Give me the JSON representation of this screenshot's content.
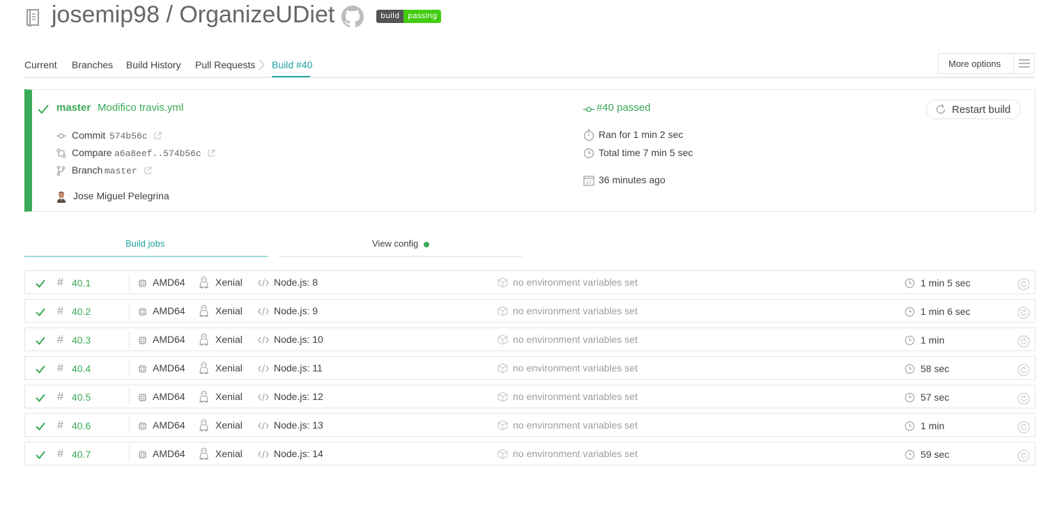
{
  "repo": {
    "owner": "josemip98",
    "separator": "/",
    "name": "OrganizeUDiet",
    "badge_left": "build",
    "badge_right": "passing"
  },
  "nav": {
    "current": "Current",
    "branches": "Branches",
    "build_history": "Build History",
    "pull_requests": "Pull Requests",
    "build": "Build #40",
    "more_options": "More options"
  },
  "build": {
    "branch": "master",
    "message": "Modifico travis.yml",
    "status": "#40 passed",
    "commit_label": "Commit",
    "commit_sha": "574b56c",
    "compare_label": "Compare",
    "compare_range": "a6a8eef..574b56c",
    "branch_label": "Branch",
    "branch_name": "master",
    "author": "Jose Miguel Pelegrina",
    "ran_for": "Ran for 1 min 2 sec",
    "total_time": "Total time 7 min 5 sec",
    "ago": "36 minutes ago",
    "calendar_day": "27",
    "restart": "Restart build"
  },
  "tabs": {
    "build_jobs": "Build jobs",
    "view_config": "View config"
  },
  "jobs": [
    {
      "hash": "#",
      "number": "40.1",
      "arch": "AMD64",
      "os": "Xenial",
      "lang": "Node.js: 8",
      "env": "no environment variables set",
      "duration": "1 min 5 sec"
    },
    {
      "hash": "#",
      "number": "40.2",
      "arch": "AMD64",
      "os": "Xenial",
      "lang": "Node.js: 9",
      "env": "no environment variables set",
      "duration": "1 min 6 sec"
    },
    {
      "hash": "#",
      "number": "40.3",
      "arch": "AMD64",
      "os": "Xenial",
      "lang": "Node.js: 10",
      "env": "no environment variables set",
      "duration": "1 min"
    },
    {
      "hash": "#",
      "number": "40.4",
      "arch": "AMD64",
      "os": "Xenial",
      "lang": "Node.js: 11",
      "env": "no environment variables set",
      "duration": "58 sec"
    },
    {
      "hash": "#",
      "number": "40.5",
      "arch": "AMD64",
      "os": "Xenial",
      "lang": "Node.js: 12",
      "env": "no environment variables set",
      "duration": "57 sec"
    },
    {
      "hash": "#",
      "number": "40.6",
      "arch": "AMD64",
      "os": "Xenial",
      "lang": "Node.js: 13",
      "env": "no environment variables set",
      "duration": "1 min"
    },
    {
      "hash": "#",
      "number": "40.7",
      "arch": "AMD64",
      "os": "Xenial",
      "lang": "Node.js: 14",
      "env": "no environment variables set",
      "duration": "59 sec"
    }
  ],
  "colors": {
    "passed": "#39aa56",
    "accent": "#1fa2a3",
    "badge_passing": "#44cc11",
    "badge_label": "#555555"
  },
  "icons": {
    "repo": "repo-icon",
    "github": "github-icon",
    "check": "check-icon",
    "commit": "commit-icon",
    "compare": "compare-icon",
    "branch": "branch-icon",
    "external": "external-link-icon",
    "stopwatch": "stopwatch-icon",
    "clock": "clock-icon",
    "calendar": "calendar-icon",
    "restart": "restart-icon",
    "cpu": "cpu-icon",
    "linux": "linux-icon",
    "code": "code-icon",
    "env": "box-icon",
    "menu": "hamburger-icon"
  }
}
